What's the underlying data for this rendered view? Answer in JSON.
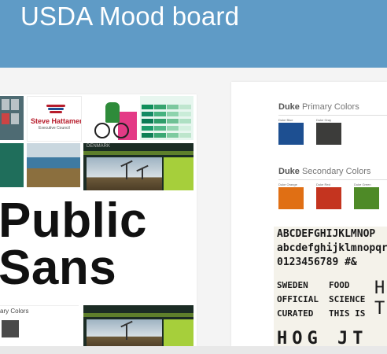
{
  "header": {
    "title": "USDA Mood board"
  },
  "left_board": {
    "logo_name": "Steve Hattamer",
    "logo_sub": "Executive Council",
    "site_header": "DENMARK",
    "type_specimen": [
      "Public",
      "Sans"
    ],
    "partial_palette_label": "ary Colors"
  },
  "right_board": {
    "primary_title_bold": "Duke",
    "primary_title": "Primary Colors",
    "primary_swatches": [
      {
        "label": "Duke Blue",
        "color": "#1d4f91"
      },
      {
        "label": "Duke Gray",
        "color": "#3c3c3a"
      }
    ],
    "secondary_title_bold": "Duke",
    "secondary_title": "Secondary Colors",
    "secondary_swatches": [
      {
        "label": "Duke Orange",
        "color": "#e06f14"
      },
      {
        "label": "Duke Red",
        "color": "#c4341f"
      },
      {
        "label": "Duke Green",
        "color": "#4e8a27"
      }
    ],
    "type_lines": [
      "ABCDEFGHIJKLMNOP",
      "abcdefghijklmnopqrs",
      "0123456789 #&"
    ],
    "word_grid": [
      [
        "SWEDEN",
        "FOOD"
      ],
      [
        "OFFICIAL",
        "SCIENCE"
      ],
      [
        "CURATED",
        "THIS IS"
      ]
    ],
    "wide_letters": [
      "H",
      "T"
    ],
    "bottom_letters": "HOG JT"
  },
  "colors": {
    "header_bg": "#5f9bc6",
    "accent_green": "#a6cf3b"
  }
}
